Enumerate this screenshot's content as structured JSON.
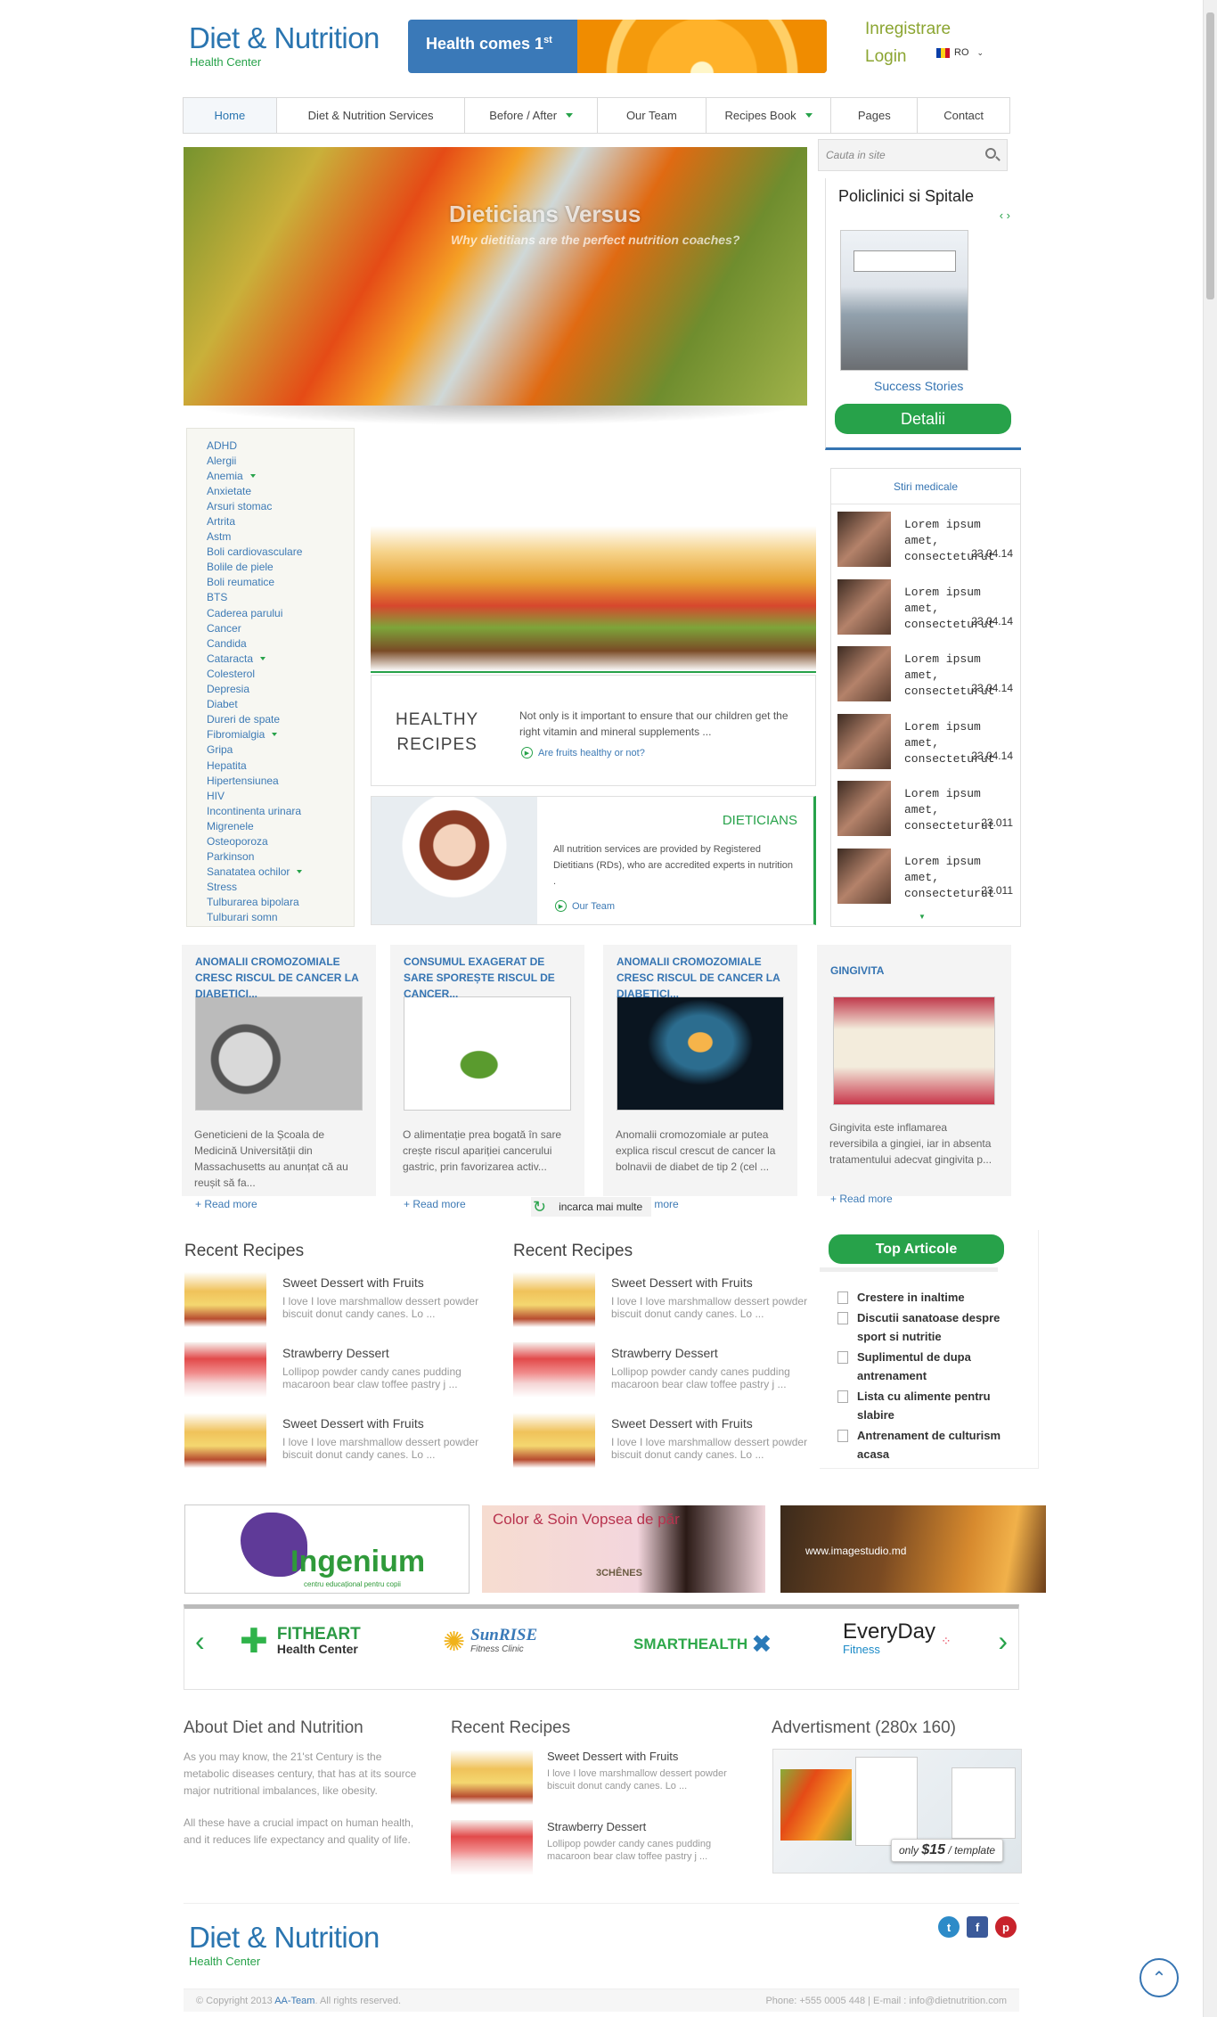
{
  "header": {
    "logo_title": "Diet & Nutrition",
    "logo_sub": "Health Center",
    "banner_text": "Health comes 1",
    "banner_sup": "st",
    "register": "Inregistrare",
    "login": "Login",
    "language": "RO"
  },
  "nav": {
    "items": [
      "Home",
      "Diet & Nutrition Services",
      "Before / After",
      "Our Team",
      "Recipes Book",
      "Pages",
      "Contact"
    ]
  },
  "search": {
    "placeholder": "Cauta in site"
  },
  "slider": {
    "title": "Dieticians Versus",
    "subtitle": "Why dietitians are the perfect nutrition coaches?"
  },
  "clinics": {
    "title": "Policlinici si Spitale",
    "caption": "Success Stories",
    "button": "Detalii"
  },
  "categories": [
    "ADHD",
    "Alergii",
    "Anemia",
    "Anxietate",
    "Arsuri stomac",
    "Artrita",
    "Astm",
    "Boli cardiovasculare",
    "Bolile de piele",
    "Boli reumatice",
    "BTS",
    "Caderea parului",
    "Cancer",
    "Candida",
    "Cataracta",
    "Colesterol",
    "Depresia",
    "Diabet",
    "Dureri de spate",
    "Fibromialgia",
    "Gripa",
    "Hepatita",
    "Hipertensiunea",
    "HIV",
    "Incontinenta urinara",
    "Migrenele",
    "Osteoporoza",
    "Parkinson",
    "Sanatatea ochilor",
    "Stress",
    "Tulburarea bipolara",
    "Tulburari somn"
  ],
  "healthy": {
    "title_line1": "HEALTHY",
    "title_line2": "RECIPES",
    "text": "Not only is it important to ensure that our children get the right vitamin and mineral supplements ...",
    "link": "Are fruits healthy or not?"
  },
  "dieticians": {
    "title": "DIETICIANS",
    "text": "All nutrition services are provided by Registered Dietitians (RDs), who are accredited experts in nutrition .",
    "link": "Our Team"
  },
  "news": {
    "title": "Stiri medicale",
    "items": [
      {
        "text": "Lorem ipsum amet, consecteturut",
        "date": "23.04.14"
      },
      {
        "text": "Lorem ipsum amet, consecteturut",
        "date": "23.04.14"
      },
      {
        "text": "Lorem ipsum amet, consecteturut",
        "date": "23.04.14"
      },
      {
        "text": "Lorem ipsum amet, consecteturut",
        "date": "23.04.14"
      },
      {
        "text": "Lorem ipsum amet, consecteturut",
        "date": "23.011"
      },
      {
        "text": "Lorem ipsum amet, consecteturut",
        "date": "23.011"
      }
    ]
  },
  "articles": [
    {
      "title": "ANOMALII CROMOZOMIALE CRESC RISCUL DE CANCER LA DIABETICI...",
      "text": "Geneticieni de la Școala de Medicină Universității din Massachusetts au anunțat că au reușit să fa...",
      "more": "+ Read more"
    },
    {
      "title": "CONSUMUL EXAGERAT DE SARE SPOREȘTE RISCUL DE CANCER...",
      "text": "O alimentație prea bogată în sare crește riscul apariției cancerului gastric, prin favorizarea activ...",
      "more": "+ Read more"
    },
    {
      "title": "ANOMALII CROMOZOMIALE CRESC RISCUL DE CANCER LA DIABETICI...",
      "text": "Anomalii cromozomiale ar putea explica riscul crescut de cancer la bolnavii de diabet de tip 2 (cel ...",
      "more": "+ Read more"
    },
    {
      "title": "GINGIVITA",
      "text": "Gingivita este inflamarea reversibila a gingiei, iar in absenta tratamentului adecvat gingivita p...",
      "more": "+ Read more"
    }
  ],
  "load_more": "incarca mai multe",
  "recent_recipes": {
    "title": "Recent Recipes",
    "items": [
      {
        "title": "Sweet Dessert with Fruits",
        "text": "I love I love marshmallow dessert powder biscuit donut candy canes. Lo ..."
      },
      {
        "title": "Strawberry Dessert",
        "text": "Lollipop powder candy canes pudding macaroon bear claw toffee pastry j ..."
      },
      {
        "title": "Sweet Dessert with Fruits",
        "text": "I love I love marshmallow dessert powder biscuit donut candy canes. Lo ..."
      }
    ]
  },
  "top_articles": {
    "title": "Top Articole",
    "items": [
      "Crestere in inaltime",
      "Discutii sanatoase despre sport si nutritie",
      "Suplimentul de dupa antrenament",
      "Lista cu alimente pentru slabire",
      "Antrenament de culturism acasa"
    ]
  },
  "ads": {
    "ingenium": "Ingenium",
    "ingenium_sub": "centru educațional pentru copii",
    "color_soin": "Color & Soin Vopsea de păr",
    "chenes": "3CHÊNES",
    "imagestudio": "www.imagestudio.md"
  },
  "brands": [
    {
      "name": "FITHEART",
      "sub": "Health Center"
    },
    {
      "name": "SunRISE",
      "sub": "Fitness Clinic"
    },
    {
      "name": "SMARTHEALTH",
      "sub": ""
    },
    {
      "name": "EveryDay",
      "sub": "Fitness"
    }
  ],
  "footer": {
    "about_title": "About Diet and Nutrition",
    "about_p1": "As you may know, the 21'st Century is the metabolic diseases century, that has at its source major nutritional imbalances, like obesity.",
    "about_p2": "All these have a crucial impact on human health, and it reduces life expectancy and quality of life.",
    "recipes_title": "Recent Recipes",
    "recipes": [
      {
        "title": "Sweet Dessert with Fruits",
        "text": "I love I love marshmallow dessert powder biscuit donut candy canes. Lo ..."
      },
      {
        "title": "Strawberry Dessert",
        "text": "Lollipop powder candy canes pudding macaroon bear claw toffee pastry j ..."
      }
    ],
    "ad_title": "Advertisment (280x 160)",
    "ad_price_prefix": "only",
    "ad_price": "$15",
    "ad_price_suffix": "/ template",
    "copyright": "© Copyright 2013",
    "team": "AA-Team",
    "rights": ". All rights reserved.",
    "contact": "Phone: +555 0005 448 | E-mail : info@dietnutrition.com"
  },
  "colors": {
    "blue": "#2a75b0",
    "green": "#27a24a",
    "olive": "#8ba531"
  }
}
